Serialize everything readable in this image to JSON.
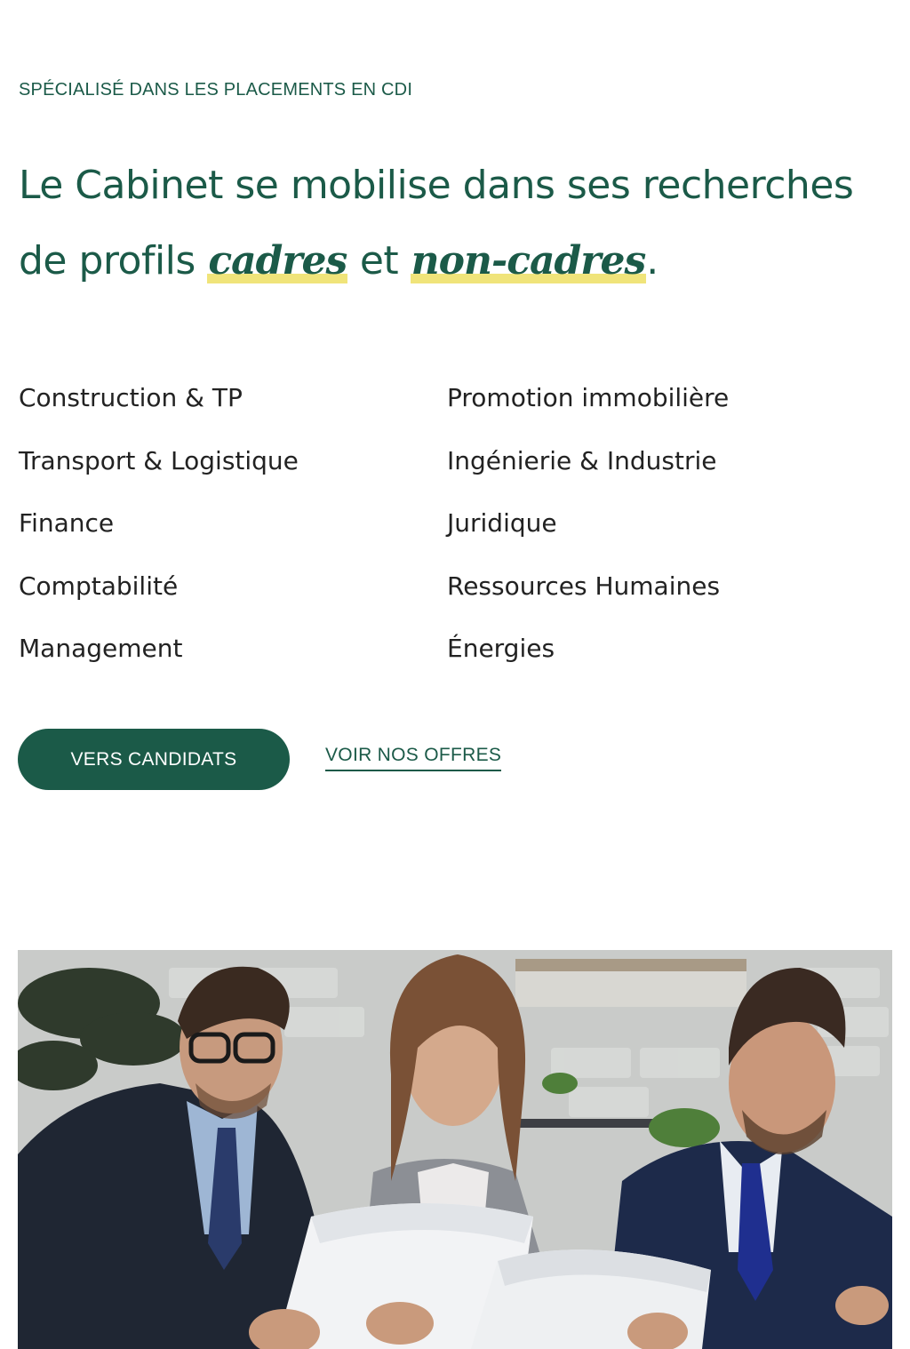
{
  "eyebrow": "SPÉCIALISÉ DANS LES PLACEMENTS EN CDI",
  "headline": {
    "part1": "Le Cabinet se mobilise dans ses recherches",
    "part2_prefix": "de profils ",
    "emph1": "cadres",
    "connector": " et ",
    "emph2": "non-cadres",
    "suffix": "."
  },
  "sectors": {
    "left": [
      "Construction & TP",
      "Transport & Logistique",
      "Finance",
      "Comptabilité",
      "Management"
    ],
    "right": [
      "Promotion immobilière",
      "Ingénierie & Industrie",
      "Juridique",
      "Ressources Humaines",
      "Énergies"
    ]
  },
  "actions": {
    "primary_label": "VERS CANDIDATS",
    "secondary_label": "VOIR NOS OFFRES"
  },
  "colors": {
    "brand_green": "#1b5a48",
    "highlight_yellow": "#f0e47a"
  },
  "image": {
    "subject": "team-photo"
  }
}
